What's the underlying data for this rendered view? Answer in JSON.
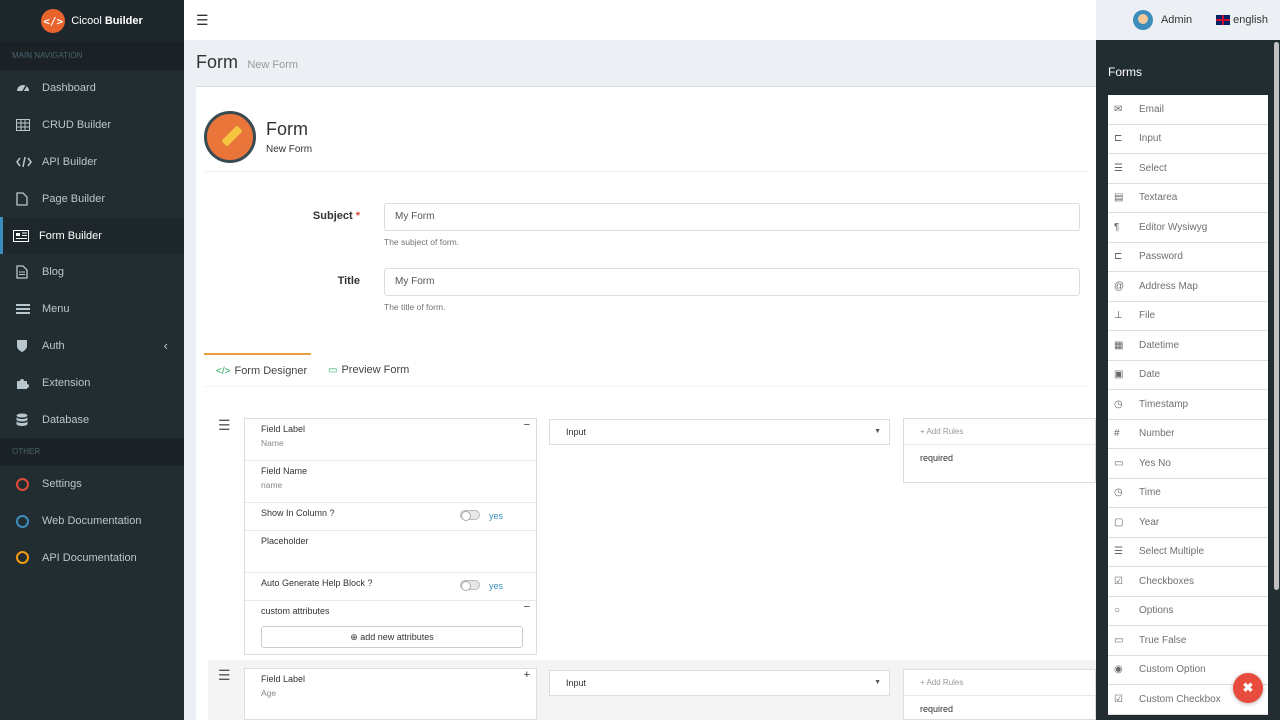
{
  "app": {
    "logo_mark": "</>",
    "logo_name_1": "Cicool",
    "logo_name_2": "Builder"
  },
  "sidebar": {
    "header_main": "MAIN NAVIGATION",
    "items": [
      {
        "label": "Dashboard",
        "icon": "dashboard-icon"
      },
      {
        "label": "CRUD Builder",
        "icon": "table-icon"
      },
      {
        "label": "API Builder",
        "icon": "code-icon"
      },
      {
        "label": "Page Builder",
        "icon": "file-icon"
      },
      {
        "label": "Form Builder",
        "icon": "newspaper-icon",
        "active": true
      },
      {
        "label": "Blog",
        "icon": "file-text-icon"
      },
      {
        "label": "Menu",
        "icon": "bars-icon"
      },
      {
        "label": "Auth",
        "icon": "shield-icon"
      },
      {
        "label": "Extension",
        "icon": "puzzle-icon"
      },
      {
        "label": "Database",
        "icon": "database-icon"
      }
    ],
    "header_other": "OTHER",
    "other": [
      {
        "label": "Settings",
        "color": "#dd4b39"
      },
      {
        "label": "Web Documentation",
        "color": "#3c8dbc"
      },
      {
        "label": "API Documentation",
        "color": "#f39c12"
      }
    ]
  },
  "topbar": {
    "user": "Admin",
    "language": "english"
  },
  "page": {
    "title": "Form",
    "subtitle": "New Form"
  },
  "form_header": {
    "title": "Form",
    "subtitle": "New Form"
  },
  "fields": {
    "subject_label": "Subject",
    "subject_required": "*",
    "subject_value": "My Form",
    "subject_help": "The subject of form.",
    "title_label": "Title",
    "title_value": "My Form",
    "title_help": "The title of form."
  },
  "tabs": {
    "designer": "Form Designer",
    "preview": "Preview Form"
  },
  "field1": {
    "field_label_lbl": "Field Label",
    "field_label_val": "Name",
    "field_name_lbl": "Field Name",
    "field_name_val": "name",
    "show_col_lbl": "Show In Column ?",
    "show_col_val": "yes",
    "placeholder_lbl": "Placeholder",
    "auto_help_lbl": "Auto Generate Help Block ?",
    "auto_help_val": "yes",
    "custom_attr_lbl": "custom attributes",
    "add_attr": "add new attributes",
    "type": "Input",
    "rules_placeholder": "+ Add Rules",
    "rule": "required"
  },
  "field2": {
    "field_label_lbl": "Field Label",
    "field_label_val": "Age",
    "type": "Input",
    "rules_placeholder": "+ Add Rules",
    "rule": "required"
  },
  "right_panel": {
    "title": "Forms",
    "items": [
      {
        "label": "Email",
        "icon": "envelope-icon",
        "glyph": "✉"
      },
      {
        "label": "Input",
        "icon": "input-icon",
        "glyph": "⊏"
      },
      {
        "label": "Select",
        "icon": "list-icon",
        "glyph": "☰"
      },
      {
        "label": "Textarea",
        "icon": "textarea-icon",
        "glyph": "▤"
      },
      {
        "label": "Editor Wysiwyg",
        "icon": "paragraph-icon",
        "glyph": "¶"
      },
      {
        "label": "Password",
        "icon": "password-icon",
        "glyph": "⊏"
      },
      {
        "label": "Address Map",
        "icon": "at-icon",
        "glyph": "@"
      },
      {
        "label": "File",
        "icon": "upload-icon",
        "glyph": "⊥"
      },
      {
        "label": "Datetime",
        "icon": "calendar-icon",
        "glyph": "▦"
      },
      {
        "label": "Date",
        "icon": "calendar-check-icon",
        "glyph": "▣"
      },
      {
        "label": "Timestamp",
        "icon": "clock-icon",
        "glyph": "◷"
      },
      {
        "label": "Number",
        "icon": "hash-icon",
        "glyph": "#"
      },
      {
        "label": "Yes No",
        "icon": "toggle-icon",
        "glyph": "▭"
      },
      {
        "label": "Time",
        "icon": "time-icon",
        "glyph": "◷"
      },
      {
        "label": "Year",
        "icon": "calendar-year-icon",
        "glyph": "▢"
      },
      {
        "label": "Select Multiple",
        "icon": "list-multiple-icon",
        "glyph": "☰"
      },
      {
        "label": "Checkboxes",
        "icon": "checkbox-icon",
        "glyph": "☑"
      },
      {
        "label": "Options",
        "icon": "radio-icon",
        "glyph": "○"
      },
      {
        "label": "True False",
        "icon": "toggle-off-icon",
        "glyph": "▭"
      },
      {
        "label": "Custom Option",
        "icon": "dot-circle-icon",
        "glyph": "◉"
      },
      {
        "label": "Custom Checkbox",
        "icon": "check-square-icon",
        "glyph": "☑"
      }
    ]
  },
  "fab": {
    "glyph": "✖"
  },
  "colors": {
    "sidebar": "#222d32",
    "accent": "#3c8dbc",
    "tab_active": "#e8a03a",
    "fab": "#e74c3c"
  }
}
